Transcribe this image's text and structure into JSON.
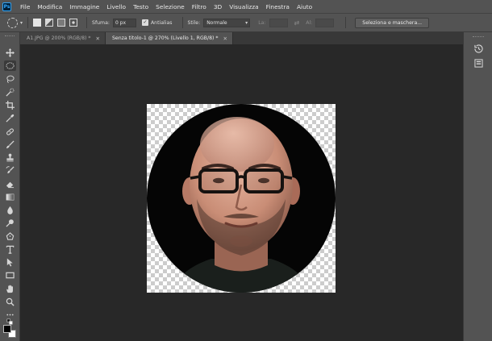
{
  "app": {
    "logo_text": "Ps"
  },
  "menu": [
    "File",
    "Modifica",
    "Immagine",
    "Livello",
    "Testo",
    "Selezione",
    "Filtro",
    "3D",
    "Visualizza",
    "Finestra",
    "Aiuto"
  ],
  "options": {
    "feather_label": "Sfuma:",
    "feather_value": "0 px",
    "antialias_label": "Antialias",
    "antialias_checked": true,
    "style_label": "Stile:",
    "style_value": "Normale",
    "width_label": "La:",
    "height_label": "Al:",
    "select_mask_button": "Seleziona e maschera..."
  },
  "tabs": [
    {
      "label": "A1.JPG @ 200% (RGB/8) *",
      "active": false
    },
    {
      "label": "Senza titolo-1 @ 270% (Livello 1, RGB/8) *",
      "active": true
    }
  ],
  "tools": [
    "move-tool",
    "elliptical-marquee-tool",
    "lasso-tool",
    "quick-selection-tool",
    "crop-tool",
    "eyedropper-tool",
    "healing-brush-tool",
    "brush-tool",
    "clone-stamp-tool",
    "history-brush-tool",
    "eraser-tool",
    "gradient-tool",
    "blur-tool",
    "dodge-tool",
    "pen-tool",
    "type-tool",
    "path-selection-tool",
    "rectangle-tool",
    "hand-tool",
    "zoom-tool",
    "edit-toolbar"
  ],
  "active_tool": "elliptical-marquee-tool",
  "colors": {
    "foreground": "#000000",
    "background": "#ffffff",
    "ui_panel": "#535353",
    "workspace": "#282828"
  },
  "right_panel_icons": [
    "history-icon",
    "libraries-icon"
  ]
}
